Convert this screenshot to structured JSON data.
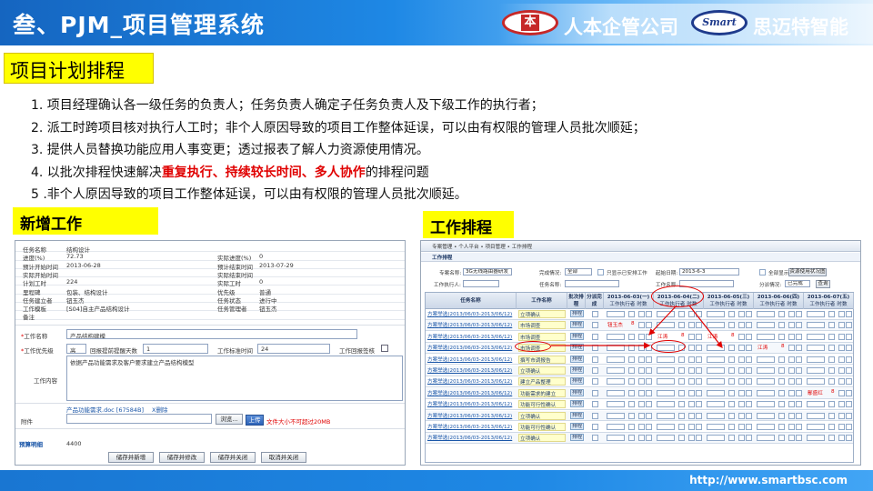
{
  "header": {
    "title": "叁、PJM_项目管理系统",
    "company1_name": "人本企管公司",
    "company1_emblem_char": "本",
    "company2_name": "思迈特智能",
    "company2_emblem_text": "Smart"
  },
  "section_title": "项目计划排程",
  "points": {
    "p1": "1. 项目经理确认各一级任务的负责人；任务负责人确定子任务负责人及下级工作的执行者；",
    "p2": "2. 派工时跨项目核对执行人工时；非个人原因导致的项目工作整体延误，可以由有权限的管理人员批次顺延；",
    "p3": "3. 提供人员替换功能应用人事变更；透过报表了解人力资源使用情况。",
    "p4_prefix": "4. 以批次排程快速解决",
    "p4_highlight": "重复执行、持续较长时间、多人协作",
    "p4_suffix": "的排程问题",
    "p5": "5 .非个人原因导致的项目工作整体延误，可以由有权限的管理人员批次顺延。"
  },
  "labels": {
    "new_work": "新增工作",
    "work_schedule": "工作排程"
  },
  "new_work_form": {
    "info_rows": [
      {
        "l1": "任务名称",
        "v1": "结构设计",
        "l2": "",
        "v2": ""
      },
      {
        "l1": "进度(%)",
        "v1": "72.73",
        "l2": "实际进度(%)",
        "v2": "0"
      },
      {
        "l1": "预计开始时间",
        "v1": "2013-06-28",
        "l2": "预计结束时间",
        "v2": "2013-07-29"
      },
      {
        "l1": "实际开始时间",
        "v1": "",
        "l2": "实际结束时间",
        "v2": ""
      },
      {
        "l1": "计划工时",
        "v1": "224",
        "l2": "实际工时",
        "v2": "0"
      },
      {
        "l1": "里程碑",
        "v1": "包装、结构设计",
        "l2": "优先级",
        "v2": "普通"
      },
      {
        "l1": "任务建立者",
        "v1": "钮玉杰",
        "l2": "任务状态",
        "v2": "进行中"
      },
      {
        "l1": "工作模板",
        "v1": "[S04]自主产品结构设计",
        "l2": "任务管理者",
        "v2": "钮玉杰"
      },
      {
        "l1": "备注",
        "v1": "",
        "l2": "",
        "v2": ""
      }
    ],
    "work_name_label": "工作名称",
    "work_name_value": "产品结构建模",
    "priority_label": "工作优先级",
    "priority_value": "高",
    "reply_days_label": "回报提前提醒天数",
    "reply_days_value": "1",
    "duration_label": "工作标准时间",
    "duration_value": "24",
    "reply_check_label": "工作回报签核",
    "content_label": "工作内容",
    "content_value": "依据产品功能需求及客户要求建立产品结构模型",
    "attach_label": "附件",
    "attach_file": "产品功能需求.doc [67584B]",
    "attach_delete": "X删除",
    "browse_label": "浏览...",
    "upload_label": "上传",
    "size_note": "文件大小不可超过20MB",
    "budget_label": "预算明细",
    "budget_value": "4400",
    "buttons": {
      "save_new": "储存并新增",
      "save_edit": "储存并修改",
      "save_close": "储存并关闭",
      "cancel_close": "取消并关闭"
    }
  },
  "schedule": {
    "breadcrumb": "专案管理 • 个人平台 • 项目管理 • 工作排程",
    "tab": "工作排程",
    "filters": {
      "project_label": "专案名称:",
      "project_value": "3G无线路由器研发",
      "status_label": "完成情况:",
      "status_value": "全部",
      "only_mine_label": "只显示已安排工作",
      "start_label": "起始日期:",
      "start_value": "2013-6-3",
      "week_label": "全部显示",
      "res_btn": "资源使用状况图",
      "executor_label": "工作执行人:",
      "task_label": "任务名称:",
      "work_label": "工作名称:",
      "split_label": "分派情况:",
      "split_value": "已完成",
      "query_btn": "查询"
    },
    "columns": {
      "task": "任务名称",
      "work": "工作名称",
      "batch": "批次排程",
      "split": "分派完成",
      "d1": "2013-06-03(一)",
      "d2": "2013-06-04(二)",
      "d3": "2013-06-05(三)",
      "d4": "2013-06-06(四)",
      "d5": "2013-06-07(五)",
      "sub_person": "工作执行者",
      "sub_hours": "时数"
    },
    "rows": [
      {
        "task": "方案举选(2013/06/03-2013/06/12)",
        "work": "立项确认",
        "btn": "排程",
        "persons": {}
      },
      {
        "task": "方案举选(2013/06/03-2013/06/12)",
        "work": "市场调查",
        "btn": "排程",
        "persons": {
          "d1": "钮玉杰",
          "d1h": "8"
        }
      },
      {
        "task": "方案举选(2013/06/03-2013/06/12)",
        "work": "市场调查",
        "btn": "排程",
        "persons": {
          "d2": "江涛",
          "d2h": "8",
          "d3": "江涛",
          "d3h": "8"
        }
      },
      {
        "task": "方案举选(2013/06/03-2013/06/12)",
        "work": "市场调查",
        "btn": "排程",
        "persons": {
          "d4": "江涛",
          "d4h": "8"
        }
      },
      {
        "task": "方案举选(2013/06/03-2013/06/12)",
        "work": "撰写市调报告",
        "btn": "排程",
        "persons": {}
      },
      {
        "task": "方案举选(2013/06/03-2013/06/12)",
        "work": "立项确认",
        "btn": "排程",
        "persons": {}
      },
      {
        "task": "方案举选(2013/06/03-2013/06/12)",
        "work": "建立产品整理",
        "btn": "排程",
        "persons": {}
      },
      {
        "task": "方案举选(2013/06/03-2013/06/12)",
        "work": "功能需求的建立",
        "btn": "排程",
        "persons": {
          "d5": "鄢盛红",
          "d5h": "8"
        }
      },
      {
        "task": "方案举选(2013/06/03-2013/06/12)",
        "work": "功能可行性确认",
        "btn": "排程",
        "persons": {}
      },
      {
        "task": "方案举选(2013/06/03-2013/06/12)",
        "work": "立项确认",
        "btn": "排程",
        "persons": {}
      },
      {
        "task": "方案举选(2013/06/03-2013/06/12)",
        "work": "功能可行性确认",
        "btn": "排程",
        "persons": {}
      },
      {
        "task": "方案举选(2013/06/03-2013/06/12)",
        "work": "立项确认",
        "btn": "排程",
        "persons": {}
      }
    ]
  },
  "footer": {
    "url": "http://www.smartbsc.com"
  }
}
